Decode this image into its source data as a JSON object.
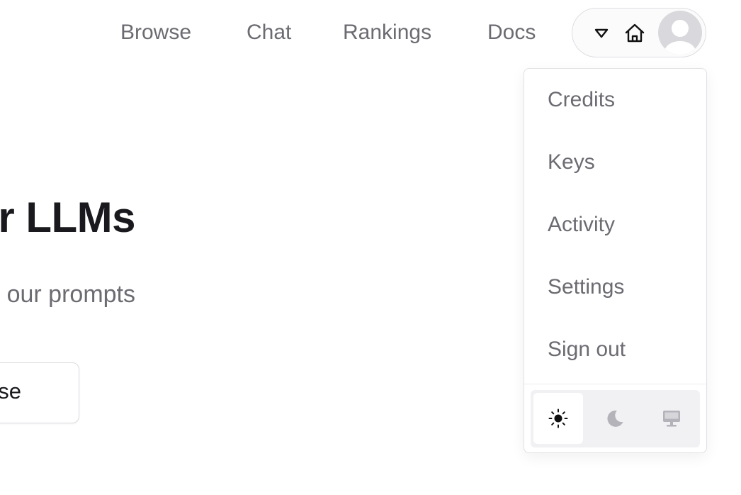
{
  "nav": {
    "links": [
      {
        "label": "Browse"
      },
      {
        "label": "Chat"
      },
      {
        "label": "Rankings"
      },
      {
        "label": "Docs"
      }
    ],
    "user_pill": {
      "icons": [
        "caret-down-icon",
        "home-icon",
        "avatar-icon"
      ]
    }
  },
  "hero": {
    "title": "or LLMs",
    "subtitle": "our prompts",
    "cta_label": "se"
  },
  "account_menu": {
    "items": [
      {
        "label": "Credits"
      },
      {
        "label": "Keys"
      },
      {
        "label": "Activity"
      },
      {
        "label": "Settings"
      },
      {
        "label": "Sign out"
      }
    ],
    "theme_options": [
      {
        "icon": "sun-icon",
        "selected": true
      },
      {
        "icon": "moon-icon",
        "selected": false
      },
      {
        "icon": "monitor-icon",
        "selected": false
      }
    ]
  },
  "colors": {
    "text_muted": "#6b6b72",
    "text_strong": "#1a1a1e",
    "border": "#e1e1e5",
    "theme_switcher_bg": "#f1f1f3",
    "avatar_bg": "#d9d9dd"
  }
}
